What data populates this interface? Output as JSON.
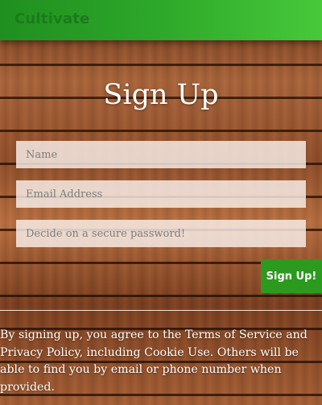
{
  "header": {
    "brand": "Cultivate",
    "colors": {
      "bar_start": "#1f8f1f",
      "bar_end": "#47c93a",
      "brand_text": "#1b7a1b"
    }
  },
  "form": {
    "title": "Sign Up",
    "fields": {
      "name": {
        "placeholder": "Name",
        "value": ""
      },
      "email": {
        "placeholder": "Email Address",
        "value": ""
      },
      "password": {
        "placeholder": "Decide on a secure password!",
        "value": ""
      }
    },
    "submit_label": "Sign Up!",
    "submit_color": "#2b9a1e"
  },
  "footer": {
    "legal_text": "By signing up, you agree to the Terms of Service and Privacy Policy, including Cookie Use. Others will be able to find you by email or phone number when provided."
  },
  "background": {
    "description_color": "#8a4a26"
  }
}
